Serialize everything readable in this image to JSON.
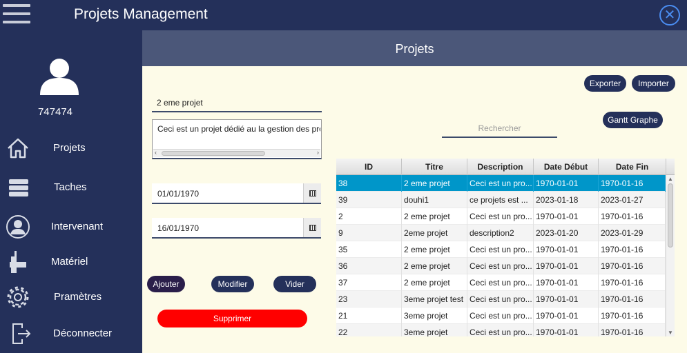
{
  "app": {
    "title": "Projets Management",
    "close_icon": "close-icon"
  },
  "sidebar": {
    "user_id": "747474",
    "items": [
      {
        "label": "Projets",
        "icon": "home-icon"
      },
      {
        "label": "Taches",
        "icon": "stack-icon"
      },
      {
        "label": "Intervenant",
        "icon": "user-icon"
      },
      {
        "label": "Matériel",
        "icon": "wrench-icon"
      },
      {
        "label": "Pramètres",
        "icon": "gear-icon"
      },
      {
        "label": "Déconnecter",
        "icon": "logout-icon"
      }
    ]
  },
  "main": {
    "title": "Projets",
    "form": {
      "titre_value": "2 eme projet",
      "description_value": "Ceci est un projet dédié au la gestion des pro",
      "date_debut_value": "01/01/1970",
      "date_fin_value": "16/01/1970"
    },
    "buttons": {
      "exporter": "Exporter",
      "importer": "Importer",
      "gantt": "Gantt Graphe",
      "ajouter": "Ajouter",
      "modifier": "Modifier",
      "vider": "Vider",
      "supprimer": "Supprimer"
    },
    "search": {
      "placeholder": "Rechercher"
    },
    "table": {
      "columns": [
        "ID",
        "Titre",
        "Description",
        "Date Début",
        "Date Fin"
      ],
      "rows": [
        [
          "38",
          "2 eme projet",
          "Ceci est un pro...",
          "1970-01-01",
          "1970-01-16"
        ],
        [
          "39",
          "douhi1",
          "ce projets est ...",
          "2023-01-18",
          "2023-01-27"
        ],
        [
          "2",
          "2 eme projet",
          "Ceci est un pro...",
          "1970-01-01",
          "1970-01-16"
        ],
        [
          "9",
          "2eme projet",
          "description2",
          "2023-01-20",
          "2023-01-29"
        ],
        [
          "35",
          "2 eme projet",
          "Ceci est un pro...",
          "1970-01-01",
          "1970-01-16"
        ],
        [
          "36",
          "2 eme projet",
          "Ceci est un pro...",
          "1970-01-01",
          "1970-01-16"
        ],
        [
          "37",
          "2 eme projet",
          "Ceci est un pro...",
          "1970-01-01",
          "1970-01-16"
        ],
        [
          "23",
          "3eme projet test",
          "Ceci est un pro...",
          "1970-01-01",
          "1970-01-16"
        ],
        [
          "21",
          "3eme projet",
          "Ceci est un pro...",
          "1970-01-01",
          "1970-01-16"
        ],
        [
          "22",
          "3eme projet",
          "Ceci est un pro...",
          "1970-01-01",
          "1970-01-16"
        ]
      ],
      "selected_row": 0
    }
  },
  "colors": {
    "sidebar_bg": "#24305a",
    "header_bg": "#4b5779",
    "content_bg": "#fdfbe8",
    "selected_row": "#0096c9",
    "danger": "#ff0000",
    "accent": "#4a8cf0"
  }
}
